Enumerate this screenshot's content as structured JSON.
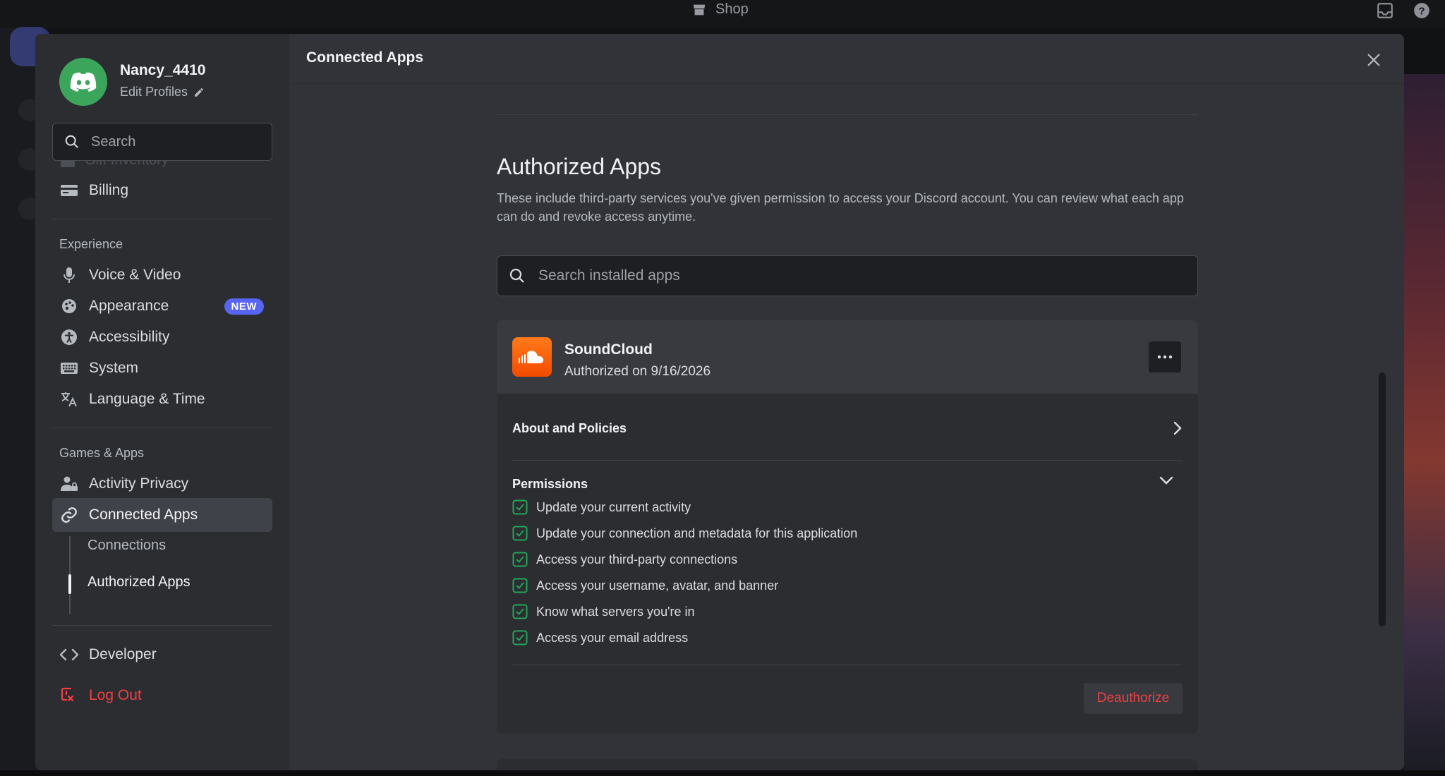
{
  "window": {
    "top_label": "Shop"
  },
  "user": {
    "name": "Nancy_4410",
    "edit_label": "Edit Profiles"
  },
  "sidebar": {
    "search_placeholder": "Search",
    "partial_item": "Gift Inventory",
    "billing": "Billing",
    "experience_header": "Experience",
    "experience_items": [
      "Voice & Video",
      "Appearance",
      "Accessibility",
      "System",
      "Language & Time"
    ],
    "new_badge": "NEW",
    "games_header": "Games & Apps",
    "activity_privacy": "Activity Privacy",
    "connected_apps": "Connected Apps",
    "sub_items": [
      "Connections",
      "Authorized Apps"
    ],
    "developer": "Developer",
    "logout": "Log Out"
  },
  "page": {
    "title": "Connected Apps",
    "heading": "Authorized Apps",
    "description": "These include third-party services you've given permission to access your Discord account. You can review what each app can do and revoke access anytime.",
    "search_placeholder": "Search installed apps"
  },
  "app": {
    "name": "SoundCloud",
    "authorized": "Authorized on 9/16/2026",
    "about": "About and Policies",
    "permissions_label": "Permissions",
    "permissions": [
      "Update your current activity",
      "Update your connection and metadata for this application",
      "Access your third-party connections",
      "Access your username, avatar, and banner",
      "Know what servers you're in",
      "Access your email address"
    ],
    "deauthorize": "Deauthorize"
  },
  "colors": {
    "accent": "#5865f2",
    "danger": "#f23f43",
    "success": "#23a55a",
    "soundcloud": "#ff5500"
  }
}
